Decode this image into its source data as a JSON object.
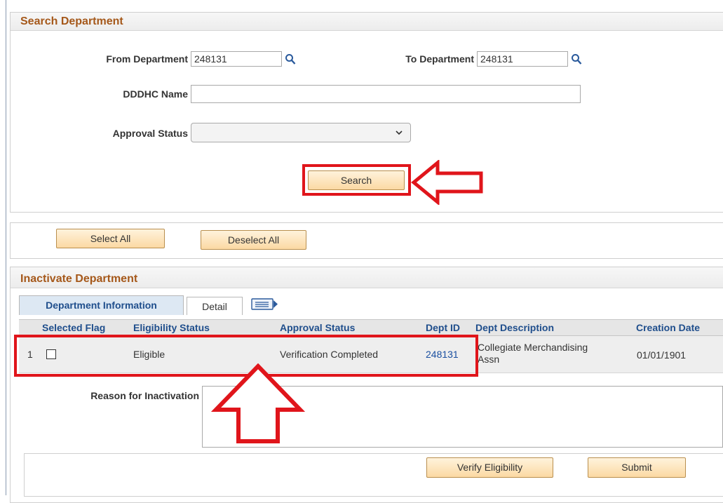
{
  "search_department": {
    "title": "Search Department",
    "from_department_label": "From Department",
    "from_department_value": "248131",
    "to_department_label": "To Department",
    "to_department_value": "248131",
    "dddhc_name_label": "DDDHC Name",
    "dddhc_name_value": "",
    "approval_status_label": "Approval Status",
    "approval_status_value": "",
    "search_button": "Search"
  },
  "selection_bar": {
    "select_all": "Select All",
    "deselect_all": "Deselect All"
  },
  "inactivate_department": {
    "title": "Inactivate Department",
    "tabs": [
      {
        "label": "Department Information",
        "active": true
      },
      {
        "label": "Detail",
        "active": false
      }
    ],
    "columns": [
      "Selected Flag",
      "Eligibility Status",
      "Approval Status",
      "Dept ID",
      "Dept Description",
      "Creation Date"
    ],
    "rows": [
      {
        "row_number": "1",
        "selected": false,
        "eligibility_status": "Eligible",
        "approval_status": "Verification Completed",
        "dept_id": "248131",
        "dept_description_line1": "Collegiate Merchandising",
        "dept_description_line2": "Assn",
        "creation_date": "01/01/1901"
      }
    ],
    "reason_label": "Reason for Inactivation",
    "reason_value": "",
    "verify_button": "Verify Eligibility",
    "submit_button": "Submit"
  },
  "colors": {
    "section_title": "#a5581a",
    "grid_header_text": "#1f4e8c",
    "link": "#1a4fa0",
    "annotation_red": "#e0151b",
    "button_fill": "#fbd9a3"
  }
}
